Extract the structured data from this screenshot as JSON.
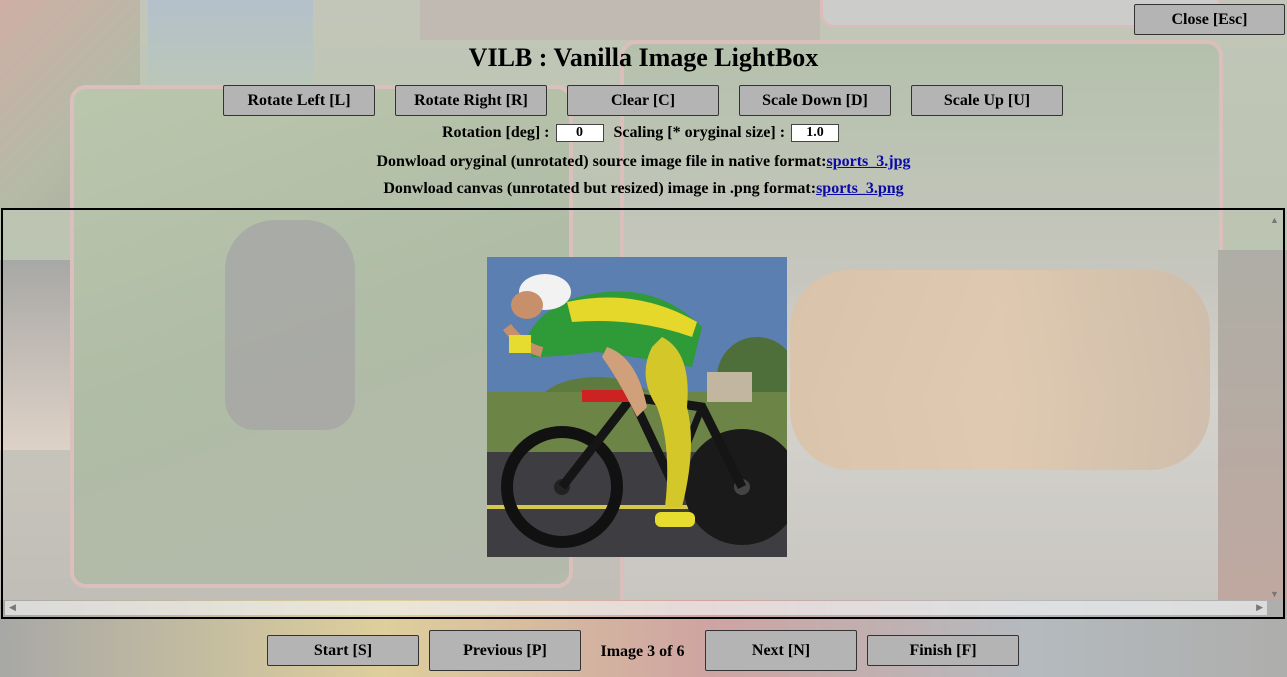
{
  "title": "VILB : Vanilla Image LightBox",
  "close_label": "Close [Esc]",
  "toolbar": {
    "rotate_left": "Rotate Left [L]",
    "rotate_right": "Rotate Right [R]",
    "clear": "Clear [C]",
    "scale_down": "Scale Down [D]",
    "scale_up": "Scale Up [U]"
  },
  "controls": {
    "rotation_label": "Rotation [deg] :",
    "rotation_value": "0",
    "scaling_label": "Scaling [* oryginal size] :",
    "scaling_value": "1.0"
  },
  "downloads": {
    "source_label": "Donwload oryginal (unrotated) source image file in native format:",
    "source_link": "sports_3.jpg",
    "canvas_label": "Donwload canvas (unrotated but resized) image in .png format:",
    "canvas_link": "sports_3.png"
  },
  "navigation": {
    "start": "Start [S]",
    "previous": "Previous [P]",
    "counter": "Image 3 of 6",
    "next": "Next [N]",
    "finish": "Finish [F]"
  },
  "colors": {
    "button_bg": "#b4b4b4",
    "link": "#0a0aa8"
  }
}
